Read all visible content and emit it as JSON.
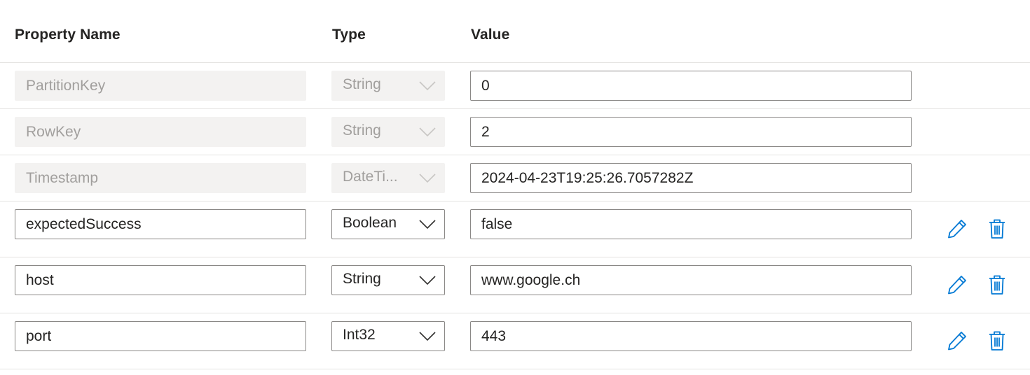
{
  "headers": {
    "name": "Property Name",
    "type": "Type",
    "value": "Value"
  },
  "rows": [
    {
      "name": "PartitionKey",
      "type": "String",
      "value": "0",
      "readonly": true
    },
    {
      "name": "RowKey",
      "type": "String",
      "value": "2",
      "readonly": true
    },
    {
      "name": "Timestamp",
      "type": "DateTi...",
      "value": "2024-04-23T19:25:26.7057282Z",
      "readonly": true
    },
    {
      "name": "expectedSuccess",
      "type": "Boolean",
      "value": "false",
      "readonly": false
    },
    {
      "name": "host",
      "type": "String",
      "value": "www.google.ch",
      "readonly": false
    },
    {
      "name": "port",
      "type": "Int32",
      "value": "443",
      "readonly": false
    }
  ],
  "icons": {
    "edit": "pencil-icon",
    "delete": "trash-icon",
    "dropdown": "chevron-down-icon"
  },
  "colors": {
    "accent": "#0078d4",
    "readonly_bg": "#f3f2f1",
    "readonly_text": "#a19f9d",
    "border": "#8a8886",
    "divider": "#e4e3e1"
  }
}
